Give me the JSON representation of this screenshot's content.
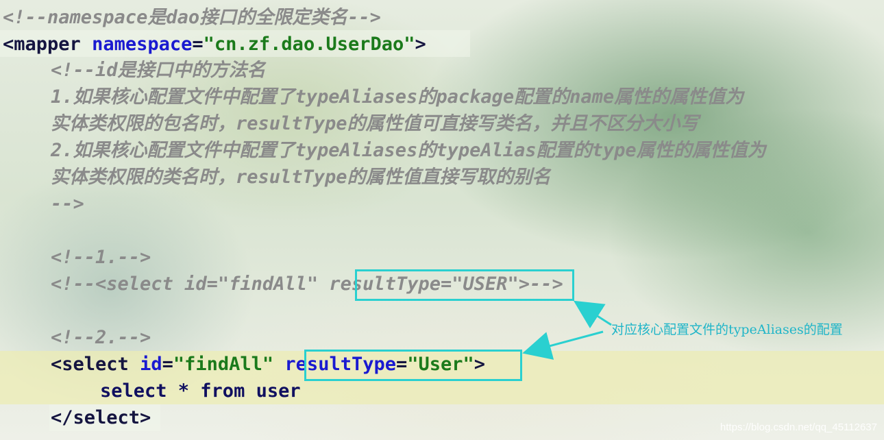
{
  "code": {
    "line1": "<!--namespace是dao接口的全限定类名-->",
    "mapper_open": "<mapper",
    "mapper_attr": "namespace",
    "mapper_eq": "=",
    "mapper_val": "\"cn.zf.dao.UserDao\"",
    "mapper_close": ">",
    "c1": "<!--id是接口中的方法名",
    "c2": "1.如果核心配置文件中配置了typeAliases的package配置的name属性的属性值为",
    "c3": "实体类权限的包名时，resultType的属性值可直接写类名，并且不区分大小写",
    "c4": "2.如果核心配置文件中配置了typeAliases的typeAlias配置的type属性的属性值为",
    "c5": "实体类权限的类名时，resultType的属性值直接写取的别名",
    "c6": "-->",
    "c7": "<!--1.-->",
    "c8a": "<!--<select id=\"findAll\" ",
    "c8b": "resultType=\"USER\"",
    "c8c": ">-->",
    "c9": "<!--2.-->",
    "sel_open": "<select",
    "sel_id_attr": "id",
    "sel_id_val": "\"findAll\"",
    "sel_rt_attr": "resultType",
    "sel_rt_val": "\"User\"",
    "sel_close": ">",
    "body": "select * from user",
    "sel_end": "</select>"
  },
  "annotation": {
    "text": "对应核心配置文件的typeAliases的配置"
  },
  "watermark": "https://blog.csdn.net/qq_45112637",
  "colors": {
    "box": "#2ad0d0",
    "annotation": "#20b5c8",
    "comment": "#8a8a8a",
    "attribute": "#1a1ad0",
    "value": "#1b7a1b"
  }
}
